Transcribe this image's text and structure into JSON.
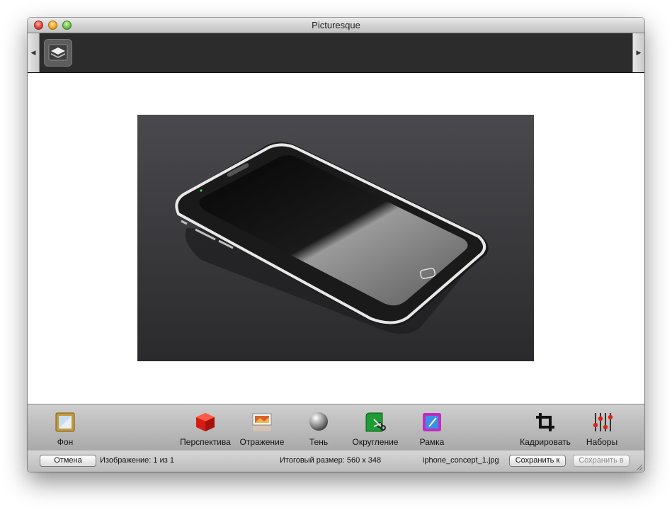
{
  "window": {
    "title": "Picturesque"
  },
  "filmstrip": {
    "prev_glyph": "◀",
    "next_glyph": "▶",
    "thumbnail_icon": "layer-thumb-icon"
  },
  "canvas": {
    "image_alt": "iphone_concept_1.jpg"
  },
  "toolbar": {
    "tools": [
      {
        "id": "background",
        "label": "Фон",
        "icon": "background-icon"
      },
      {
        "id": "perspective",
        "label": "Перспектива",
        "icon": "perspective-cube-icon"
      },
      {
        "id": "reflection",
        "label": "Отражение",
        "icon": "reflection-icon"
      },
      {
        "id": "shadow",
        "label": "Тень",
        "icon": "shadow-sphere-icon"
      },
      {
        "id": "rounding",
        "label": "Округление",
        "icon": "rounding-scissors-icon"
      },
      {
        "id": "frame",
        "label": "Рамка",
        "icon": "frame-icon"
      },
      {
        "id": "crop",
        "label": "Кадрировать",
        "icon": "crop-icon"
      },
      {
        "id": "presets",
        "label": "Наборы",
        "icon": "presets-sliders-icon"
      }
    ]
  },
  "status": {
    "cancel_label": "Отмена",
    "image_counter": "Изображение: 1 из 1",
    "output_size": "Итоговый размер: 560 x 348",
    "filename": "iphone_concept_1.jpg",
    "save_to_label": "Сохранить к",
    "save_in_label": "Сохранить в"
  },
  "colors": {
    "filmstrip_bg": "#2c2c2c",
    "photo_bg": "#38383b",
    "accent_red": "#e0443e"
  }
}
